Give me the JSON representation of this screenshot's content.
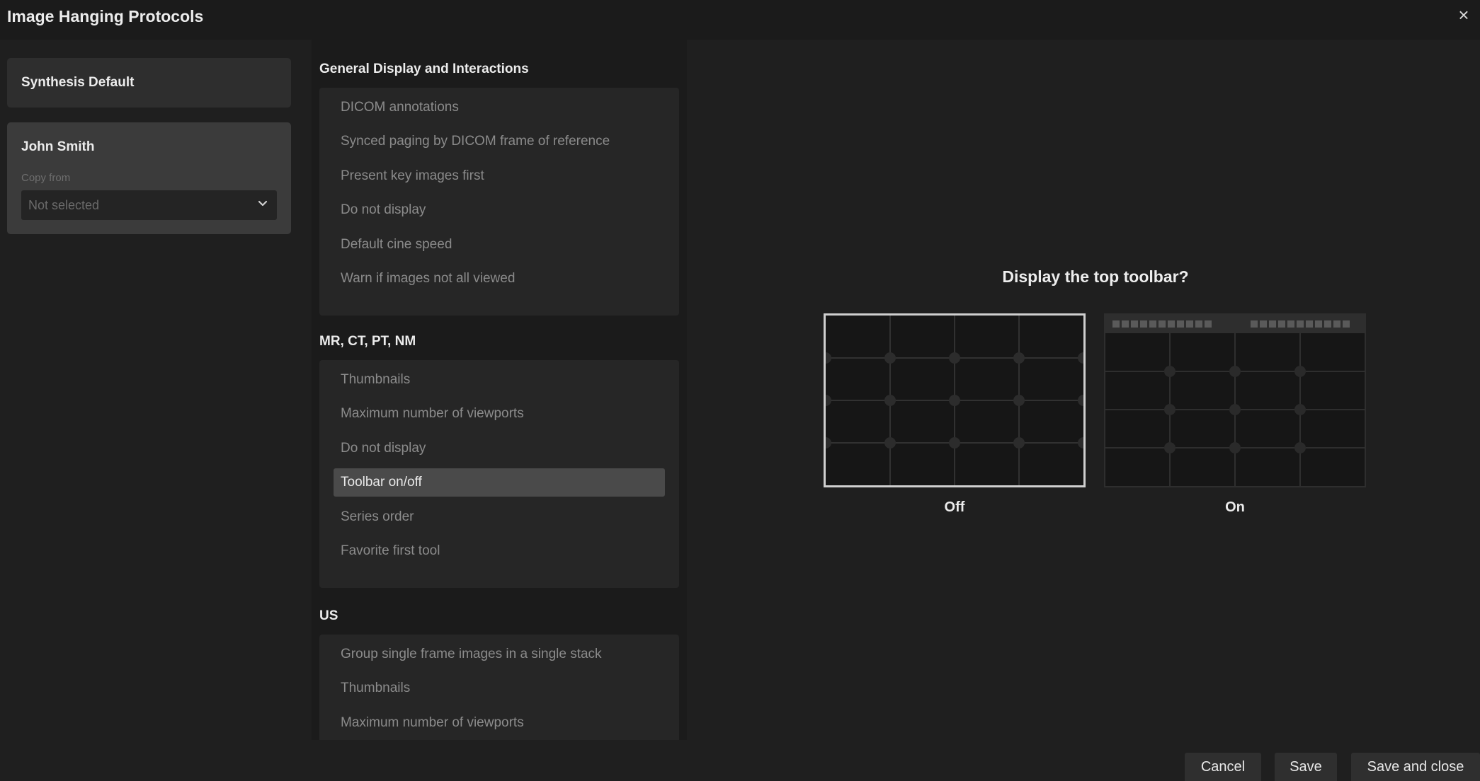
{
  "window": {
    "title": "Image Hanging Protocols",
    "close_icon": "×"
  },
  "profiles": {
    "default_name": "Synthesis Default",
    "user_name": "John Smith",
    "copy_from_label": "Copy from",
    "copy_from_value": "Not selected"
  },
  "sections": {
    "general": {
      "heading": "General Display and Interactions",
      "items": [
        "DICOM annotations",
        "Synced paging by DICOM frame of reference",
        "Present key images first",
        "Do not display",
        "Default cine speed",
        "Warn if images not all viewed"
      ]
    },
    "mrct": {
      "heading": "MR, CT, PT, NM",
      "items": [
        "Thumbnails",
        "Maximum number of viewports",
        "Do not display",
        "Toolbar on/off",
        "Series order",
        "Favorite first tool"
      ],
      "active_item": "Toolbar on/off"
    },
    "us": {
      "heading": "US",
      "items": [
        "Group single frame images in a single stack",
        "Thumbnails",
        "Maximum number of viewports"
      ]
    }
  },
  "preview": {
    "question": "Display the top toolbar?",
    "options": [
      {
        "label": "Off",
        "selected": true
      },
      {
        "label": "On",
        "selected": false
      }
    ]
  },
  "footer": {
    "cancel_label": "Cancel",
    "save_label": "Save",
    "save_close_label": "Save and close"
  },
  "colors": {
    "background": "#1f1f1f",
    "panel": "#262626",
    "active_item": "#4a4a4a",
    "selected_border": "#cfcfcf"
  },
  "icons": {
    "close": "close-icon",
    "dropdown": "chevron-down-icon"
  }
}
